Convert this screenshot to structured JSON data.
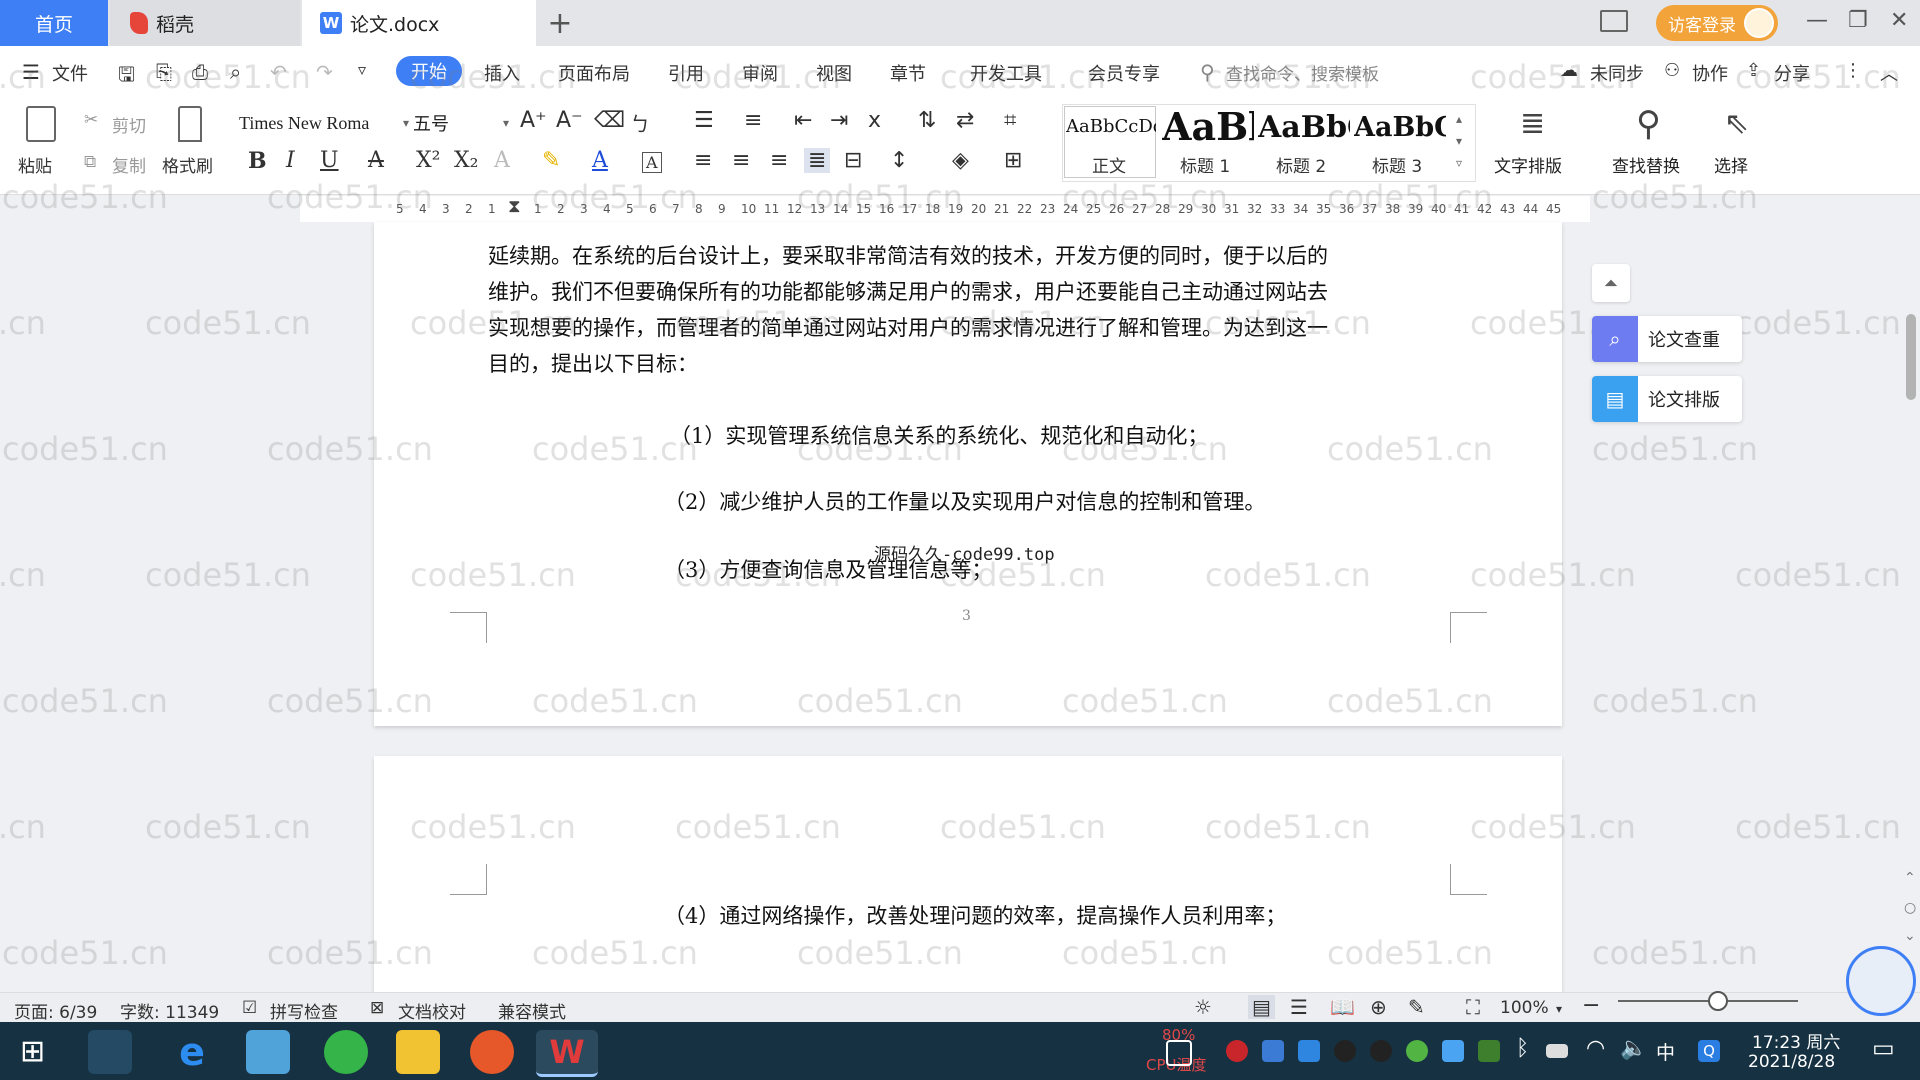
{
  "tabs": {
    "home": "首页",
    "daoke": "稻壳",
    "document": "论文.docx",
    "add": "+"
  },
  "titlebar": {
    "guest_login": "访客登录"
  },
  "menu": {
    "file": "文件",
    "start": "开始",
    "insert": "插入",
    "page_layout": "页面布局",
    "reference": "引用",
    "review": "审阅",
    "view": "视图",
    "chapter": "章节",
    "dev_tools": "开发工具",
    "member": "会员专享",
    "search_placeholder": "查找命令、搜索模板",
    "unsync": "未同步",
    "collab": "协作",
    "share": "分享"
  },
  "ribbon": {
    "paste": "粘贴",
    "cut": "剪切",
    "copy": "复制",
    "format_painter": "格式刷",
    "font_name": "Times New Roma",
    "font_size": "五号",
    "styles": [
      {
        "sample": "AaBbCcDd",
        "label": "正文"
      },
      {
        "sample": "AaBb",
        "label": "标题 1"
      },
      {
        "sample": "AaBbC",
        "label": "标题 2"
      },
      {
        "sample": "AaBbC",
        "label": "标题 3"
      }
    ],
    "text_layout": "文字排版",
    "find_replace": "查找替换",
    "select": "选择"
  },
  "ruler": {
    "ticks": [
      "5",
      "4",
      "3",
      "2",
      "1",
      "",
      "1",
      "2",
      "3",
      "4",
      "5",
      "6",
      "7",
      "8",
      "9",
      "10",
      "11",
      "12",
      "13",
      "14",
      "15",
      "16",
      "17",
      "18",
      "19",
      "20",
      "21",
      "22",
      "23",
      "24",
      "25",
      "26",
      "27",
      "28",
      "29",
      "30",
      "31",
      "32",
      "33",
      "34",
      "35",
      "36",
      "37",
      "38",
      "39",
      "40",
      "41",
      "42",
      "43",
      "44",
      "45"
    ]
  },
  "document": {
    "page1_lines": [
      "延续期。在系统的后台设计上，要采取非常简洁有效的技术，开发方便的同时，便于以后的",
      "维护。我们不但要确保所有的功能都能够满足用户的需求，用户还要能自己主动通过网站去",
      "实现想要的操作，而管理者的简单通过网站对用户的需求情况进行了解和管理。为达到这一",
      "目的，提出以下目标："
    ],
    "goal1": "（1）实现管理系统信息关系的系统化、规范化和自动化；",
    "goal2": "（2）减少维护人员的工作量以及实现用户对信息的控制和管理。",
    "goal3": "（3）方便查询信息及管理信息等；",
    "overlay_text": "源码久久-code99.top",
    "page_number": "3",
    "goal4": "（4）通过网络操作，改善处理问题的效率，提高操作人员利用率；"
  },
  "watermark": "code51.cn",
  "side_panel": {
    "plagiarism_check": "论文查重",
    "thesis_layout": "论文排版"
  },
  "status": {
    "page": "页面: 6/39",
    "word_count": "字数: 11349",
    "spell_check": "拼写检查",
    "proofread": "文档校对",
    "compat_mode": "兼容模式",
    "zoom": "100%"
  },
  "taskbar": {
    "time": "17:23 周六",
    "date": "2021/8/28",
    "cpu_percent": "80%",
    "cpu_label": "CPU温度",
    "ime": "中"
  },
  "colors": {
    "accent": "#3f7ff5",
    "guest_button": "#f2a33a",
    "taskbar": "#163142",
    "plagiarism_icon": "#6d7cf0",
    "layout_icon": "#3aa0f0"
  }
}
